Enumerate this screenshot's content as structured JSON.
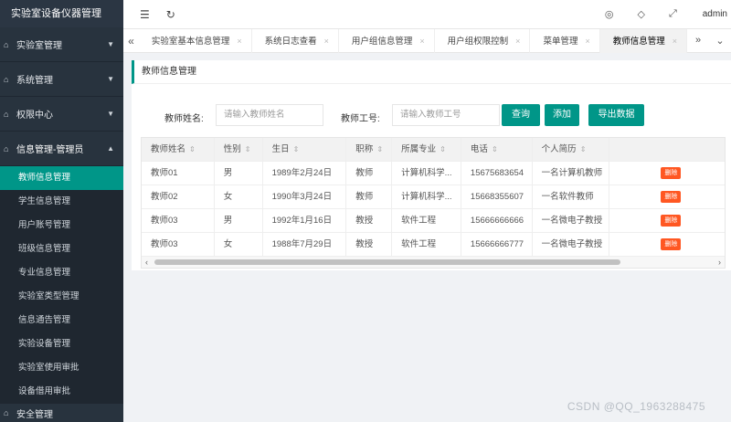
{
  "brand": "实验室设备仪器管理",
  "sidebar": {
    "groups": [
      {
        "label": "实验室管理"
      },
      {
        "label": "系统管理"
      },
      {
        "label": "权限中心"
      },
      {
        "label": "信息管理-管理员"
      }
    ],
    "items": [
      {
        "label": "教师信息管理"
      },
      {
        "label": "学生信息管理"
      },
      {
        "label": "用户账号管理"
      },
      {
        "label": "班级信息管理"
      },
      {
        "label": "专业信息管理"
      },
      {
        "label": "实验室类型管理"
      },
      {
        "label": "信息通告管理"
      },
      {
        "label": "实验设备管理"
      },
      {
        "label": "实验室使用审批"
      },
      {
        "label": "设备借用审批"
      }
    ],
    "partial": "安全管理"
  },
  "header": {
    "user": "admin"
  },
  "tabs": [
    {
      "label": "实验室基本信息管理"
    },
    {
      "label": "系统日志查看"
    },
    {
      "label": "用户组信息管理"
    },
    {
      "label": "用户组权限控制"
    },
    {
      "label": "菜单管理"
    },
    {
      "label": "教师信息管理"
    }
  ],
  "card": {
    "title": "教师信息管理"
  },
  "filter": {
    "name_label": "教师姓名:",
    "name_placeholder": "请输入教师姓名",
    "id_label": "教师工号:",
    "id_placeholder": "请输入教师工号",
    "search": "查询",
    "add": "添加",
    "export": "导出数据"
  },
  "table": {
    "columns": [
      "教师姓名",
      "性别",
      "生日",
      "职称",
      "所属专业",
      "电话",
      "个人简历"
    ],
    "rows": [
      [
        "教师01",
        "男",
        "1989年2月24日",
        "教师",
        "计算机科学...",
        "15675683654",
        "一名计算机教师",
        "删除"
      ],
      [
        "教师02",
        "女",
        "1990年3月24日",
        "教师",
        "计算机科学...",
        "15668355607",
        "一名软件教师",
        "删除"
      ],
      [
        "教师03",
        "男",
        "1992年1月16日",
        "教授",
        "软件工程",
        "15666666666",
        "一名微电子教授",
        "删除"
      ],
      [
        "教师03",
        "女",
        "1988年7月29日",
        "教授",
        "软件工程",
        "15666666777",
        "一名微电子教授",
        "删除"
      ]
    ]
  },
  "watermark": "CSDN @QQ_1963288475",
  "colors": {
    "accent": "#009688",
    "sidebar": "#28333e",
    "danger": "#ff5722"
  }
}
